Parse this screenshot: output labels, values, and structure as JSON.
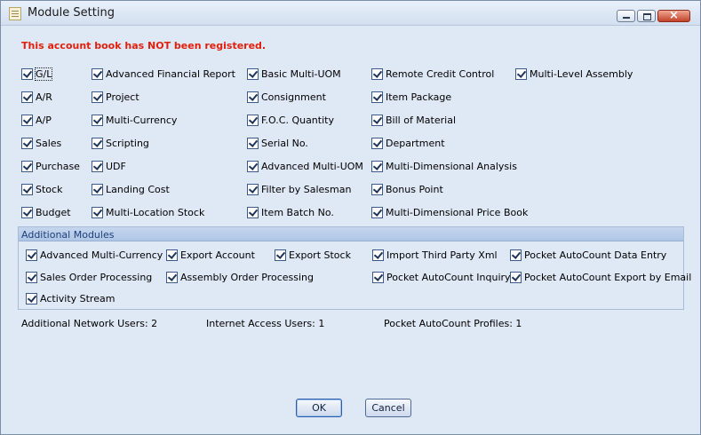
{
  "window": {
    "title": "Module Setting"
  },
  "warning": "This account book has NOT been registered.",
  "modules": {
    "col1": [
      "G/L",
      "A/R",
      "A/P",
      "Sales",
      "Purchase",
      "Stock",
      "Budget"
    ],
    "col2": [
      "Advanced Financial Report",
      "Project",
      "Multi-Currency",
      "Scripting",
      "UDF",
      "Landing Cost",
      "Multi-Location Stock"
    ],
    "col3": [
      "Basic Multi-UOM",
      "Consignment",
      "F.O.C. Quantity",
      "Serial No.",
      "Advanced Multi-UOM",
      "Filter by Salesman",
      "Item Batch No."
    ],
    "col4": [
      "Remote Credit Control",
      "Item Package",
      "Bill of Material",
      "Department",
      "Multi-Dimensional Analysis",
      "Bonus Point",
      "Multi-Dimensional Price Book"
    ],
    "col5": [
      "Multi-Level Assembly"
    ]
  },
  "additional": {
    "title": "Additional Modules",
    "row1": [
      "Advanced Multi-Currency",
      "Export Account",
      "Export Stock",
      "Import Third Party Xml",
      "Pocket AutoCount Data Entry"
    ],
    "row2": [
      "Sales Order Processing",
      "Assembly Order Processing",
      "Pocket AutoCount Inquiry",
      "Pocket AutoCount Export by Email"
    ],
    "row3": [
      "Activity Stream"
    ]
  },
  "stats": {
    "network_users_label": "Additional Network Users:",
    "network_users_value": "2",
    "internet_users_label": "Internet Access Users:",
    "internet_users_value": "1",
    "pocket_profiles_label": "Pocket AutoCount Profiles:",
    "pocket_profiles_value": "1"
  },
  "buttons": {
    "ok": "OK",
    "cancel": "Cancel"
  }
}
